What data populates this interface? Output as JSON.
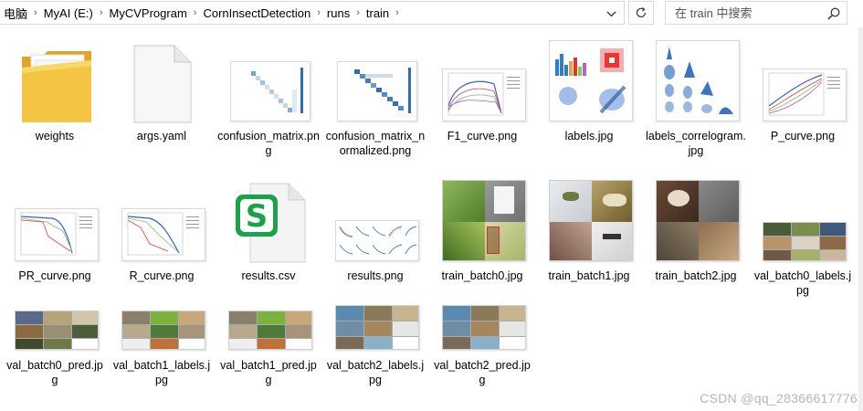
{
  "address": {
    "crumbs": [
      "电脑",
      "MyAI (E:)",
      "MyCVProgram",
      "CornInsectDetection",
      "runs",
      "train"
    ]
  },
  "search": {
    "placeholder": "在 train 中搜索"
  },
  "files": [
    {
      "name": "weights",
      "kind": "folder"
    },
    {
      "name": "args.yaml",
      "kind": "document"
    },
    {
      "name": "confusion_matrix.png",
      "kind": "confusion-matrix"
    },
    {
      "name": "confusion_matrix_normalized.png",
      "kind": "confusion-matrix"
    },
    {
      "name": "F1_curve.png",
      "kind": "curve"
    },
    {
      "name": "labels.jpg",
      "kind": "labels"
    },
    {
      "name": "labels_correlogram.jpg",
      "kind": "correlogram"
    },
    {
      "name": "P_curve.png",
      "kind": "curve"
    },
    {
      "name": "PR_curve.png",
      "kind": "pr-curve"
    },
    {
      "name": "R_curve.png",
      "kind": "pr-curve"
    },
    {
      "name": "results.csv",
      "kind": "csv"
    },
    {
      "name": "results.png",
      "kind": "results"
    },
    {
      "name": "train_batch0.jpg",
      "kind": "batch"
    },
    {
      "name": "train_batch1.jpg",
      "kind": "batch"
    },
    {
      "name": "train_batch2.jpg",
      "kind": "batch"
    },
    {
      "name": "val_batch0_labels.jpg",
      "kind": "val-batch"
    },
    {
      "name": "val_batch0_pred.jpg",
      "kind": "val-batch"
    },
    {
      "name": "val_batch1_labels.jpg",
      "kind": "val-batch"
    },
    {
      "name": "val_batch1_pred.jpg",
      "kind": "val-batch"
    },
    {
      "name": "val_batch2_labels.jpg",
      "kind": "val-batch"
    },
    {
      "name": "val_batch2_pred.jpg",
      "kind": "val-batch"
    }
  ],
  "watermark": "CSDN @qq_28366617776",
  "colors": {
    "folder": "#f4c542",
    "folder_dark": "#e0a526",
    "csv_green": "#1aa34a",
    "accent": "#0078d7"
  }
}
